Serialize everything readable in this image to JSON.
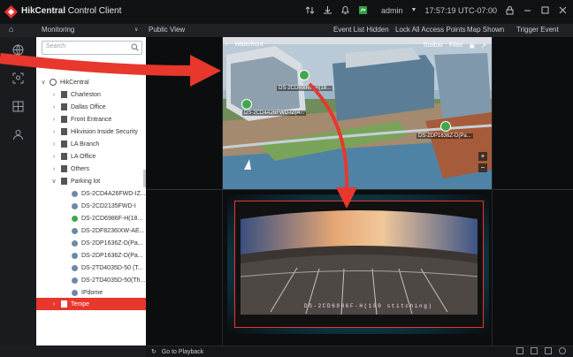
{
  "app": {
    "brand": "HikCentral",
    "title_suffix": " Control Client"
  },
  "titlebar": {
    "user": "admin",
    "time": "17:57:19 UTC-07:00"
  },
  "subbar": {
    "module": "Monitoring",
    "view": "Public View",
    "event_list": "Event List Hidden",
    "lock": "Lock All Access Points",
    "map_shown": "Map Shown",
    "trigger_event": "Trigger Event"
  },
  "tree": {
    "search_placeholder": "Search",
    "root": "HikCentral",
    "sites": [
      "Charleston",
      "Dallas Office",
      "Front Entrance",
      "Hikvision Inside Security",
      "LA Branch",
      "LA Office",
      "Others",
      "Parking lot"
    ],
    "cameras": [
      "DS-2CD4A26FWD-IZ...",
      "DS-2CD2135FWD-I",
      "DS-2CD6986F-H(18...",
      "DS-2DF8236IXW-AE...",
      "DS-2DP1636Z-D(Pa...",
      "DS-2DP1636Z-D(Pa...",
      "DS-2TD4035D-50 (T...",
      "DS-2TD4035D-50(Th...",
      "IPdome"
    ],
    "selected": "Tempe"
  },
  "map": {
    "breadcrumb": "Waterfront",
    "toolbar_label": "Toolbar",
    "filter_label": "Filter",
    "pins": [
      "DS-2CD6986F-H(18...",
      "DS-2CD4A26FWD-IZ(A...",
      "DS-2DP1636Z-D(Pa..."
    ]
  },
  "video": {
    "overlay": "DS-2CD6986F-H(180 stitching)"
  },
  "bottombar": {
    "playback": "Go to Playback"
  },
  "colors": {
    "accent": "#e8372d",
    "pin": "#3fa84a",
    "selection": "#e8372d"
  }
}
